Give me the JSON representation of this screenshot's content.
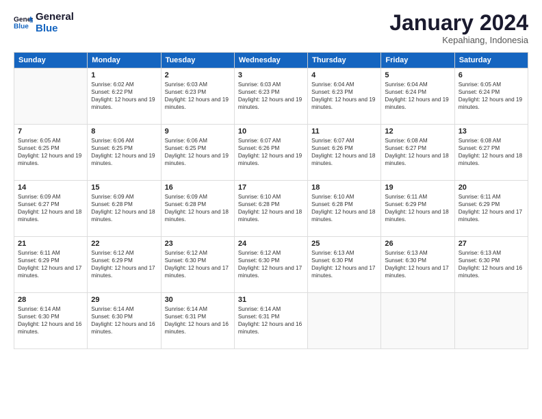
{
  "logo": {
    "line1": "General",
    "line2": "Blue"
  },
  "header": {
    "month_year": "January 2024",
    "location": "Kepahiang, Indonesia"
  },
  "days_of_week": [
    "Sunday",
    "Monday",
    "Tuesday",
    "Wednesday",
    "Thursday",
    "Friday",
    "Saturday"
  ],
  "weeks": [
    [
      {
        "day": "",
        "info": ""
      },
      {
        "day": "1",
        "sunrise": "6:02 AM",
        "sunset": "6:22 PM",
        "daylight": "12 hours and 19 minutes."
      },
      {
        "day": "2",
        "sunrise": "6:03 AM",
        "sunset": "6:23 PM",
        "daylight": "12 hours and 19 minutes."
      },
      {
        "day": "3",
        "sunrise": "6:03 AM",
        "sunset": "6:23 PM",
        "daylight": "12 hours and 19 minutes."
      },
      {
        "day": "4",
        "sunrise": "6:04 AM",
        "sunset": "6:23 PM",
        "daylight": "12 hours and 19 minutes."
      },
      {
        "day": "5",
        "sunrise": "6:04 AM",
        "sunset": "6:24 PM",
        "daylight": "12 hours and 19 minutes."
      },
      {
        "day": "6",
        "sunrise": "6:05 AM",
        "sunset": "6:24 PM",
        "daylight": "12 hours and 19 minutes."
      }
    ],
    [
      {
        "day": "7",
        "sunrise": "6:05 AM",
        "sunset": "6:25 PM",
        "daylight": "12 hours and 19 minutes."
      },
      {
        "day": "8",
        "sunrise": "6:06 AM",
        "sunset": "6:25 PM",
        "daylight": "12 hours and 19 minutes."
      },
      {
        "day": "9",
        "sunrise": "6:06 AM",
        "sunset": "6:25 PM",
        "daylight": "12 hours and 19 minutes."
      },
      {
        "day": "10",
        "sunrise": "6:07 AM",
        "sunset": "6:26 PM",
        "daylight": "12 hours and 19 minutes."
      },
      {
        "day": "11",
        "sunrise": "6:07 AM",
        "sunset": "6:26 PM",
        "daylight": "12 hours and 18 minutes."
      },
      {
        "day": "12",
        "sunrise": "6:08 AM",
        "sunset": "6:27 PM",
        "daylight": "12 hours and 18 minutes."
      },
      {
        "day": "13",
        "sunrise": "6:08 AM",
        "sunset": "6:27 PM",
        "daylight": "12 hours and 18 minutes."
      }
    ],
    [
      {
        "day": "14",
        "sunrise": "6:09 AM",
        "sunset": "6:27 PM",
        "daylight": "12 hours and 18 minutes."
      },
      {
        "day": "15",
        "sunrise": "6:09 AM",
        "sunset": "6:28 PM",
        "daylight": "12 hours and 18 minutes."
      },
      {
        "day": "16",
        "sunrise": "6:09 AM",
        "sunset": "6:28 PM",
        "daylight": "12 hours and 18 minutes."
      },
      {
        "day": "17",
        "sunrise": "6:10 AM",
        "sunset": "6:28 PM",
        "daylight": "12 hours and 18 minutes."
      },
      {
        "day": "18",
        "sunrise": "6:10 AM",
        "sunset": "6:28 PM",
        "daylight": "12 hours and 18 minutes."
      },
      {
        "day": "19",
        "sunrise": "6:11 AM",
        "sunset": "6:29 PM",
        "daylight": "12 hours and 18 minutes."
      },
      {
        "day": "20",
        "sunrise": "6:11 AM",
        "sunset": "6:29 PM",
        "daylight": "12 hours and 17 minutes."
      }
    ],
    [
      {
        "day": "21",
        "sunrise": "6:11 AM",
        "sunset": "6:29 PM",
        "daylight": "12 hours and 17 minutes."
      },
      {
        "day": "22",
        "sunrise": "6:12 AM",
        "sunset": "6:29 PM",
        "daylight": "12 hours and 17 minutes."
      },
      {
        "day": "23",
        "sunrise": "6:12 AM",
        "sunset": "6:30 PM",
        "daylight": "12 hours and 17 minutes."
      },
      {
        "day": "24",
        "sunrise": "6:12 AM",
        "sunset": "6:30 PM",
        "daylight": "12 hours and 17 minutes."
      },
      {
        "day": "25",
        "sunrise": "6:13 AM",
        "sunset": "6:30 PM",
        "daylight": "12 hours and 17 minutes."
      },
      {
        "day": "26",
        "sunrise": "6:13 AM",
        "sunset": "6:30 PM",
        "daylight": "12 hours and 17 minutes."
      },
      {
        "day": "27",
        "sunrise": "6:13 AM",
        "sunset": "6:30 PM",
        "daylight": "12 hours and 16 minutes."
      }
    ],
    [
      {
        "day": "28",
        "sunrise": "6:14 AM",
        "sunset": "6:30 PM",
        "daylight": "12 hours and 16 minutes."
      },
      {
        "day": "29",
        "sunrise": "6:14 AM",
        "sunset": "6:30 PM",
        "daylight": "12 hours and 16 minutes."
      },
      {
        "day": "30",
        "sunrise": "6:14 AM",
        "sunset": "6:31 PM",
        "daylight": "12 hours and 16 minutes."
      },
      {
        "day": "31",
        "sunrise": "6:14 AM",
        "sunset": "6:31 PM",
        "daylight": "12 hours and 16 minutes."
      },
      {
        "day": "",
        "info": ""
      },
      {
        "day": "",
        "info": ""
      },
      {
        "day": "",
        "info": ""
      }
    ]
  ],
  "labels": {
    "sunrise": "Sunrise: ",
    "sunset": "Sunset: ",
    "daylight": "Daylight: "
  }
}
